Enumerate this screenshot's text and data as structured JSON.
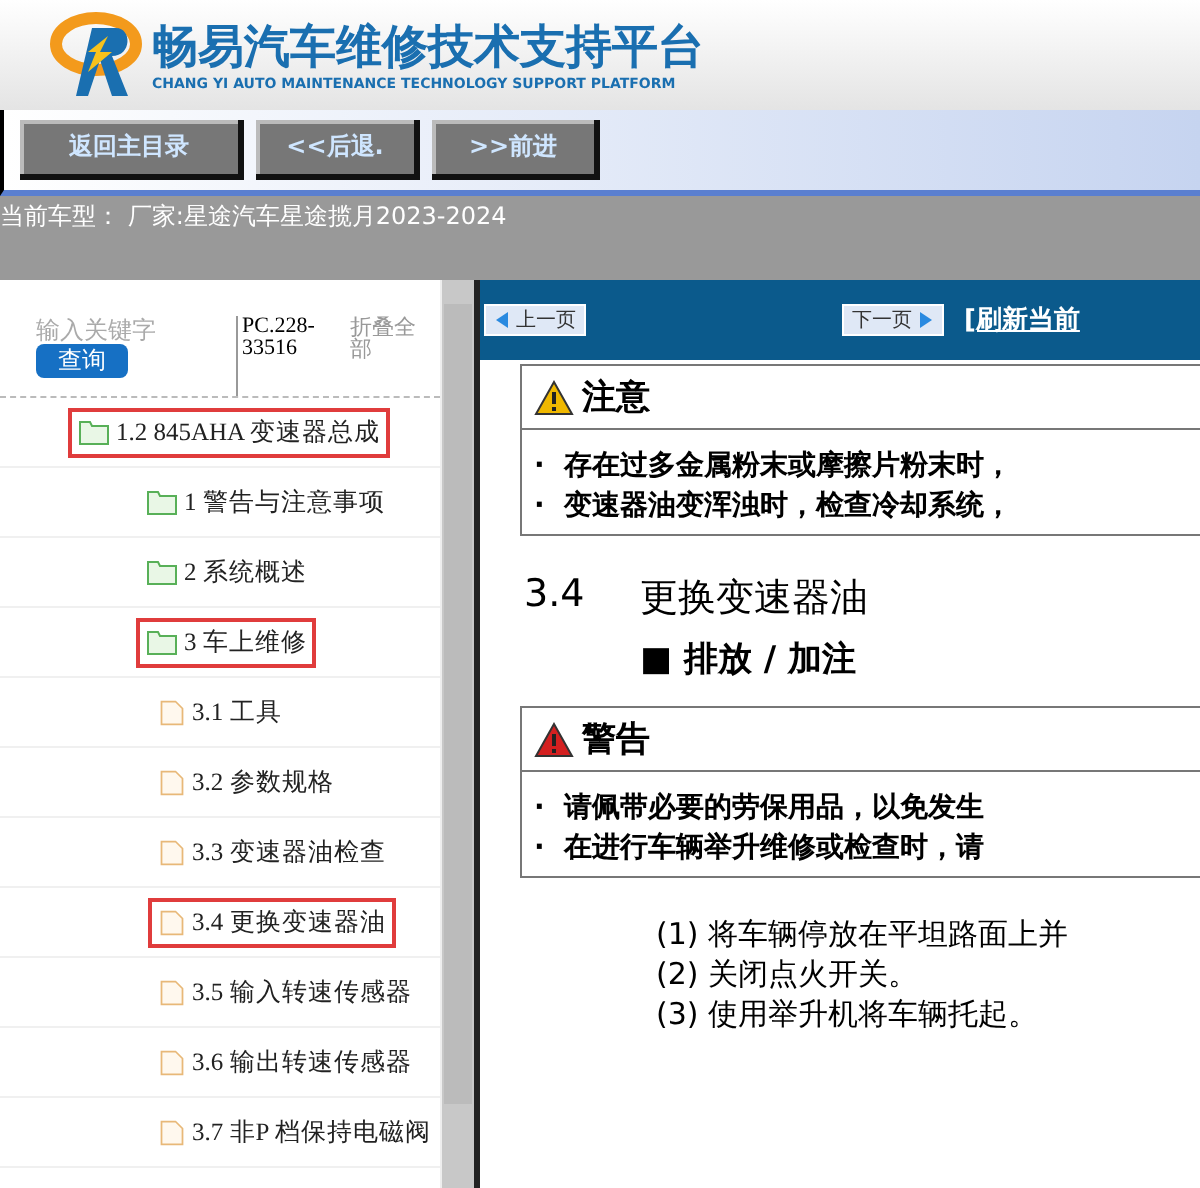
{
  "header": {
    "title": "畅易汽车维修技术支持平台",
    "subtitle": "CHANG YI AUTO MAINTENANCE TECHNOLOGY SUPPORT PLATFORM"
  },
  "nav_buttons": [
    "返回主目录",
    "<<后退.",
    ">>前进"
  ],
  "current_model": "当前车型： 厂家:星途汽车星途揽月2023-2024",
  "sidebar": {
    "search": {
      "placeholder": "输入关键字"
    },
    "search_button": "查询",
    "code": "PC.228-33516",
    "collapse_all": "折叠全部",
    "tree": [
      {
        "label": "1.2 845AHA 变速器总成",
        "kind": "folder",
        "highlighted": true,
        "children": [
          {
            "label": "1 警告与注意事项",
            "kind": "folder",
            "highlighted": false
          },
          {
            "label": "2 系统概述",
            "kind": "folder",
            "highlighted": false
          },
          {
            "label": "3 车上维修",
            "kind": "folder",
            "highlighted": true,
            "children": [
              {
                "label": "3.1 工具",
                "kind": "page",
                "highlighted": false
              },
              {
                "label": "3.2 参数规格",
                "kind": "page",
                "highlighted": false
              },
              {
                "label": "3.3 变速器油检查",
                "kind": "page",
                "highlighted": false
              },
              {
                "label": "3.4 更换变速器油",
                "kind": "page",
                "highlighted": true
              },
              {
                "label": "3.5 输入转速传感器",
                "kind": "page",
                "highlighted": false
              },
              {
                "label": "3.6 输出转速传感器",
                "kind": "page",
                "highlighted": false
              },
              {
                "label": "3.7 非P 档保持电磁阀",
                "kind": "page",
                "highlighted": false
              }
            ]
          }
        ]
      }
    ]
  },
  "toolbar": {
    "prev": "上一页",
    "next": "下一页",
    "refresh": "[刷新当前"
  },
  "document": {
    "blocks": [
      {
        "kind": "caution",
        "title": "注意",
        "bullets": [
          "·  存在过多金属粉末或摩擦片粉末时，",
          "·  变速器油变浑浊时，检查冷却系统，"
        ]
      },
      {
        "kind": "heading",
        "number": "3.4",
        "text": "更换变速器油"
      },
      {
        "kind": "subheading",
        "text": "■ 排放 / 加注"
      },
      {
        "kind": "warning",
        "title": "警告",
        "bullets": [
          "·  请佩带必要的劳保用品，以免发生",
          "·  在进行车辆举升维修或检查时，请"
        ]
      },
      {
        "kind": "steps",
        "items": [
          "(1) 将车辆停放在平坦路面上并",
          "(2) 关闭点火开关。",
          "(3) 使用举升机将车辆托起。"
        ]
      }
    ]
  }
}
